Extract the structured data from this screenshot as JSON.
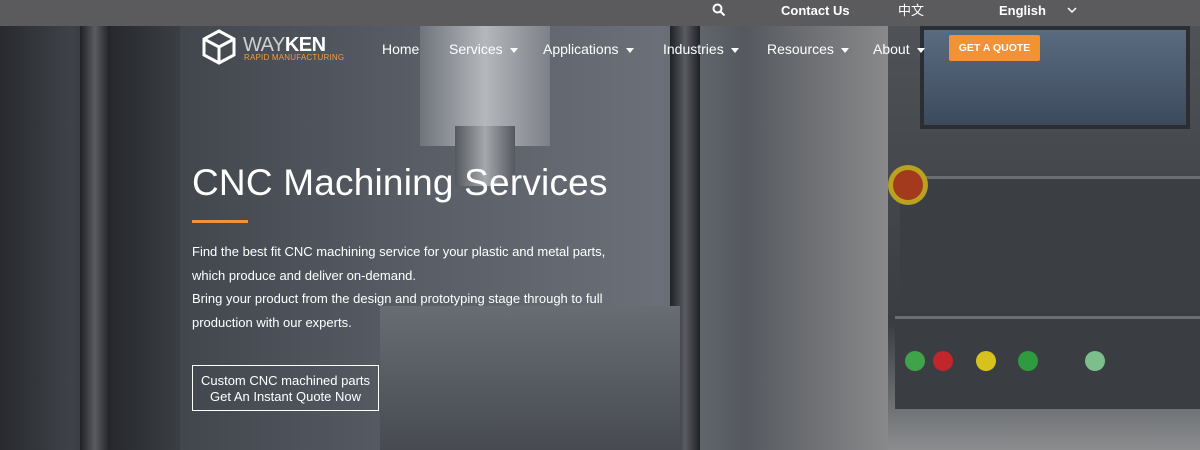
{
  "topbar": {
    "search_icon": "search-icon",
    "contact": "Contact Us",
    "chinese": "中文",
    "language": "English"
  },
  "logo": {
    "way": "WAY",
    "ken": "KEN",
    "subtitle": "RAPID MANUFACTURING"
  },
  "nav": {
    "home": "Home",
    "services": "Services",
    "applications": "Applications",
    "industries": "Industries",
    "resources": "Resources",
    "about": "About",
    "quote": "GET A QUOTE"
  },
  "hero": {
    "title": "CNC Machining Services",
    "line1": "Find the best fit CNC machining service for your plastic and metal parts,",
    "line2": "which produce and deliver on-demand.",
    "line3": "Bring your product from the design and prototyping stage through to full",
    "line4": "production with our experts.",
    "cta_line1": "Custom CNC machined parts",
    "cta_line2": "Get An Instant Quote Now"
  },
  "colors": {
    "accent": "#f29237",
    "topbar": "#5b5b5d"
  }
}
